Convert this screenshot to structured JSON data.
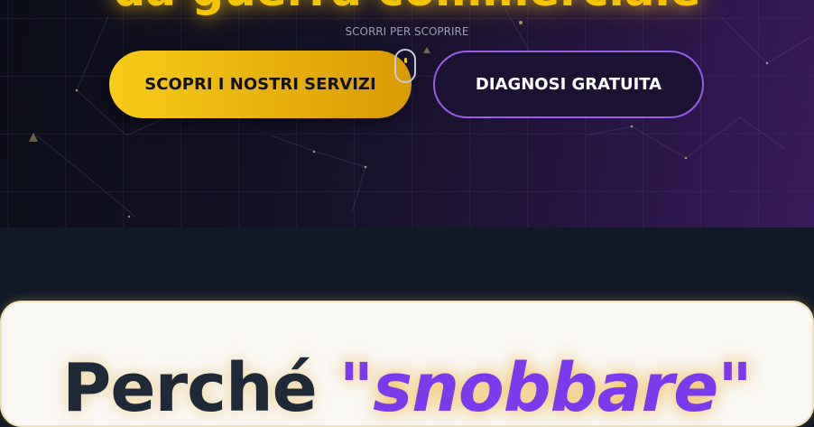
{
  "hero": {
    "headline": "da guerra commerciale",
    "scroll_hint": "SCORRI PER SCOPRIRE",
    "primary_button": "SCOPRI I NOSTRI SERVIZI",
    "secondary_button": "DIAGNOSI GRATUITA"
  },
  "section": {
    "title_start": "Perché ",
    "title_quoted": "\"snobbare\""
  },
  "colors": {
    "accent_gold": "#f4c400",
    "accent_purple": "#7c3aed",
    "hero_dark": "#0b0d18",
    "section_bg": "#111827"
  }
}
